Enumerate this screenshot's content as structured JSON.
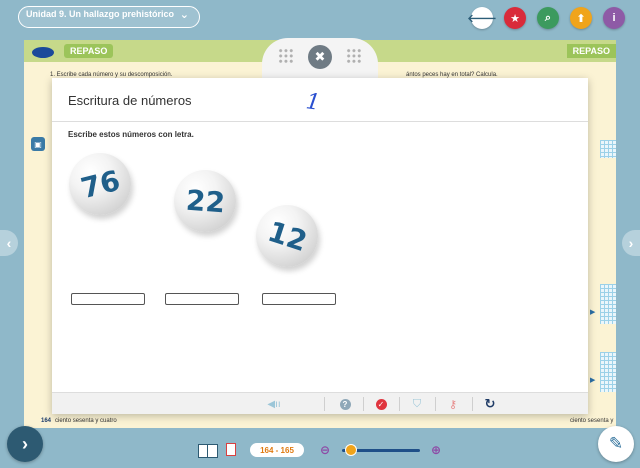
{
  "header": {
    "unit_title": "Unidad 9. Un hallazgo prehistórico",
    "chevron_icon": "chevron-down-icon",
    "buttons": [
      {
        "name": "back-button",
        "icon": "arrow-left-icon",
        "glyph": "🡐",
        "color": "#ffffff"
      },
      {
        "name": "favorites-button",
        "icon": "star-icon",
        "glyph": "★",
        "color": "#d92b3a"
      },
      {
        "name": "search-button",
        "icon": "magnifier-icon",
        "glyph": "⌕",
        "color": "#3c9a5e"
      },
      {
        "name": "upload-button",
        "icon": "arrow-up-icon",
        "glyph": "⬆",
        "color": "#f0a41b"
      },
      {
        "name": "info-button",
        "icon": "info-icon",
        "glyph": "i",
        "color": "#8e5aa6"
      }
    ]
  },
  "book": {
    "section_left": "REPASO",
    "section_right": "REPASO",
    "exercise_left": "1. Escribe cada número y su descomposición.",
    "exercise_right": "ántos peces hay en total? Calcula.",
    "page_left_number": "164",
    "page_left_words": "ciento sesenta y cuatro",
    "page_right_words": "ciento sesenta y"
  },
  "modal": {
    "title": "Escritura de números",
    "handwritten_mark": "1",
    "instruction": "Escribe estos números con letra.",
    "balls": [
      {
        "number": "76"
      },
      {
        "number": "22"
      },
      {
        "number": "12"
      }
    ],
    "answers": [
      "",
      "",
      ""
    ],
    "toolbar": [
      {
        "name": "audio-button",
        "icon": "speaker-icon"
      },
      {
        "name": "help-button",
        "icon": "question-icon"
      },
      {
        "name": "check-button",
        "icon": "checkmark-icon"
      },
      {
        "name": "solution-button",
        "icon": "shield-check-icon"
      },
      {
        "name": "key-button",
        "icon": "key-icon"
      },
      {
        "name": "reset-button",
        "icon": "reset-icon"
      }
    ]
  },
  "footer": {
    "page_range": "164 - 165",
    "zoom_level": 0.12,
    "accent_color": "#f0a41b"
  }
}
